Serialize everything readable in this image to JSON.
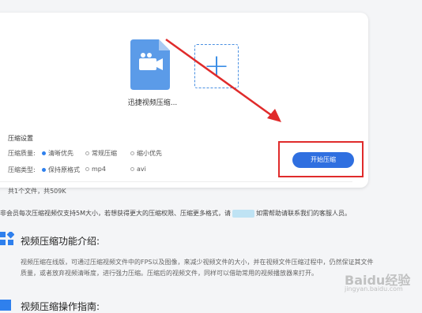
{
  "file": {
    "name": "迅捷视频压缩...",
    "icon": "video-file-icon"
  },
  "add_tile": {
    "symbol": "+"
  },
  "settings": {
    "title": "压缩设置",
    "quality": {
      "label": "压缩质量:",
      "options": [
        "清晰优先",
        "常规压缩",
        "缩小优先"
      ],
      "selected": 0
    },
    "type": {
      "label": "压缩类型:",
      "options": [
        "保持原格式",
        "mp4",
        "avi"
      ],
      "selected": 0
    }
  },
  "file_count": "共1个文件，共509K",
  "start_button": {
    "label": "开始压缩"
  },
  "notice": {
    "before": "非会员每次压缩视频仅支持5M大小，若想获得更大的压缩权限、压缩更多格式，请",
    "after": "如需帮助请联系我们的客服人员。"
  },
  "intro_section": {
    "title": "视频压缩功能介绍:",
    "body": "视频压缩在线版，可通过压缩视频文件中的FPS以及图像，来减少视频文件的大小，并在视频文件压缩过程中，仍然保证其文件质量，或者放弃视频清晰度，进行强力压缩。压缩后的视频文件，同样可以借助常用的视频播放器来打开。"
  },
  "guide_section": {
    "title": "视频压缩操作指南:"
  },
  "watermark": {
    "text": "Baidu经验",
    "sub": "jingyan.baidu.com"
  },
  "colors": {
    "accent": "#2f6fe0",
    "annotation": "#e02b2b",
    "file_tile": "#5b9be8"
  }
}
